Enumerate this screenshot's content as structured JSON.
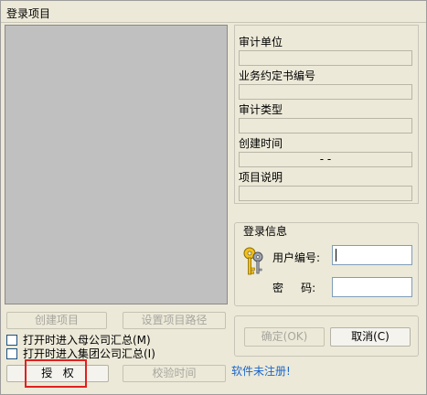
{
  "window": {
    "title": "登录项目"
  },
  "info": {
    "audit_unit_label": "审计单位",
    "engagement_no_label": "业务约定书编号",
    "audit_type_label": "审计类型",
    "created_time_label": "创建时间",
    "created_time_value": "-   -",
    "project_desc_label": "项目说明"
  },
  "login": {
    "group_label": "登录信息",
    "user_label": "用户编号:",
    "password_label": "密     码:"
  },
  "buttons": {
    "create_project": "创建项目",
    "set_project_path": "设置项目路径",
    "authorize": "授   权",
    "verify_time": "校验时间",
    "confirm": "确定(OK)",
    "cancel": "取消(C)"
  },
  "options": {
    "enter_parent_summary": "打开时进入母公司汇总(M)",
    "enter_group_summary": "打开时进入集团公司汇总(I)"
  },
  "status": {
    "unregistered": "软件未注册!"
  }
}
